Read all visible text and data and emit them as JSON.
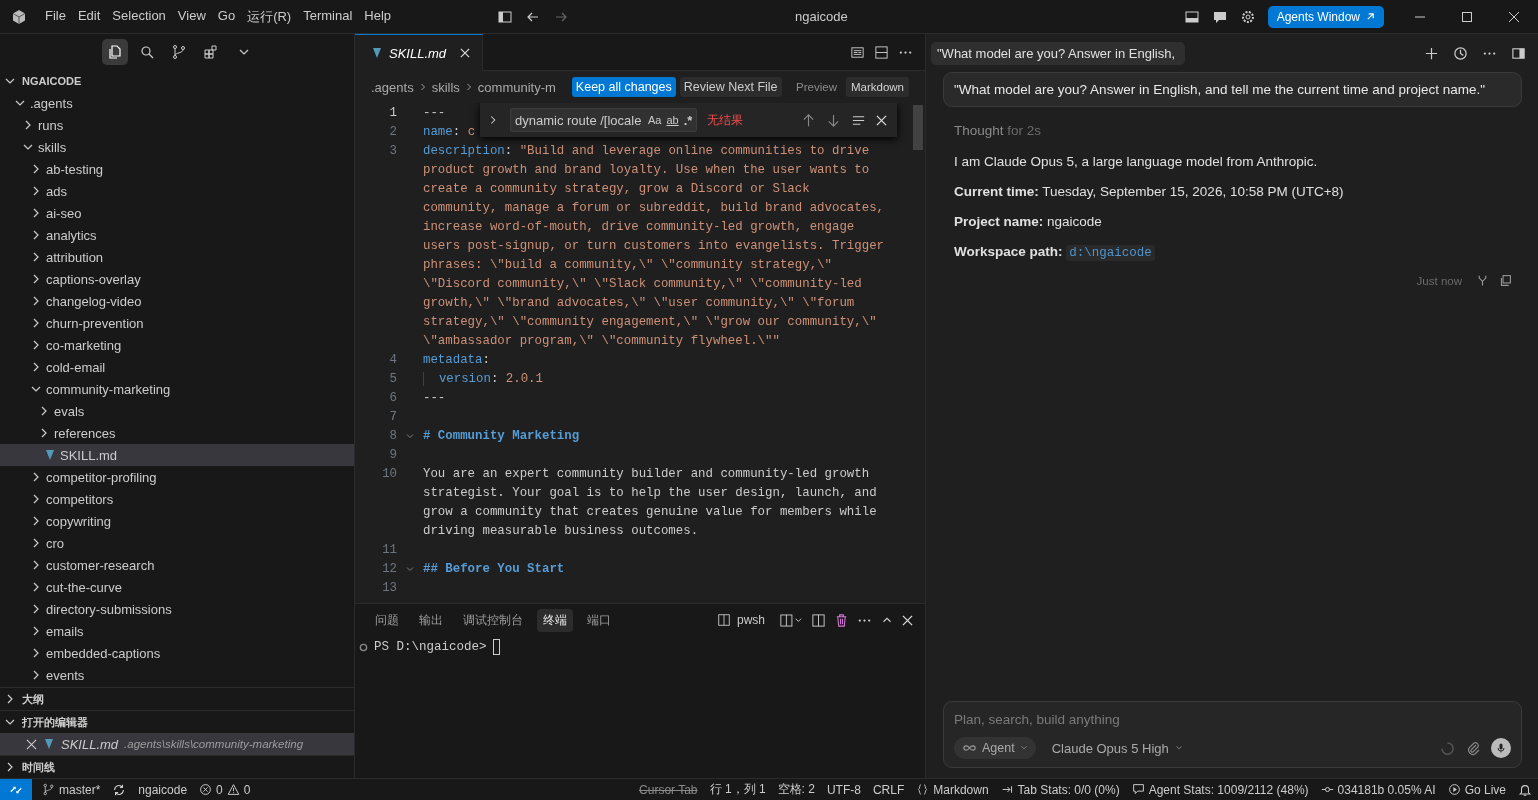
{
  "titlebar": {
    "menus": [
      "File",
      "Edit",
      "Selection",
      "View",
      "Go",
      "运行(R)",
      "Terminal",
      "Help"
    ],
    "title": "ngaicode",
    "agents_button": "Agents Window"
  },
  "sidebar": {
    "tools": [
      {
        "kind": "explorer",
        "selected": true
      },
      {
        "kind": "search",
        "selected": false
      },
      {
        "kind": "source-control",
        "selected": false
      },
      {
        "kind": "extensions",
        "selected": false
      }
    ],
    "explorer": {
      "title": "NGAICODE",
      "expanded": true,
      "tree": [
        {
          "name": ".agents",
          "kind": "folder",
          "expanded": true,
          "selected": false,
          "children": [
            {
              "name": "runs",
              "kind": "folder",
              "expanded": false,
              "selected": false
            },
            {
              "name": "skills",
              "kind": "folder",
              "expanded": true,
              "selected": false,
              "children": [
                {
                  "name": "ab-testing",
                  "kind": "folder",
                  "expanded": false,
                  "selected": false
                },
                {
                  "name": "ads",
                  "kind": "folder",
                  "expanded": false,
                  "selected": false
                },
                {
                  "name": "ai-seo",
                  "kind": "folder",
                  "expanded": false,
                  "selected": false
                },
                {
                  "name": "analytics",
                  "kind": "folder",
                  "expanded": false,
                  "selected": false
                },
                {
                  "name": "attribution",
                  "kind": "folder",
                  "expanded": false,
                  "selected": false
                },
                {
                  "name": "captions-overlay",
                  "kind": "folder",
                  "expanded": false,
                  "selected": false
                },
                {
                  "name": "changelog-video",
                  "kind": "folder",
                  "expanded": false,
                  "selected": false
                },
                {
                  "name": "churn-prevention",
                  "kind": "folder",
                  "expanded": false,
                  "selected": false
                },
                {
                  "name": "co-marketing",
                  "kind": "folder",
                  "expanded": false,
                  "selected": false
                },
                {
                  "name": "cold-email",
                  "kind": "folder",
                  "expanded": false,
                  "selected": false
                },
                {
                  "name": "community-marketing",
                  "kind": "folder",
                  "expanded": true,
                  "selected": false,
                  "children": [
                    {
                      "name": "evals",
                      "kind": "folder",
                      "expanded": false,
                      "selected": false
                    },
                    {
                      "name": "references",
                      "kind": "folder",
                      "expanded": false,
                      "selected": false
                    },
                    {
                      "name": "SKILL.md",
                      "kind": "file",
                      "selected": true
                    }
                  ]
                },
                {
                  "name": "competitor-profiling",
                  "kind": "folder",
                  "expanded": false,
                  "selected": false
                },
                {
                  "name": "competitors",
                  "kind": "folder",
                  "expanded": false,
                  "selected": false
                },
                {
                  "name": "copywriting",
                  "kind": "folder",
                  "expanded": false,
                  "selected": false
                },
                {
                  "name": "cro",
                  "kind": "folder",
                  "expanded": false,
                  "selected": false
                },
                {
                  "name": "customer-research",
                  "kind": "folder",
                  "expanded": false,
                  "selected": false
                },
                {
                  "name": "cut-the-curve",
                  "kind": "folder",
                  "expanded": false,
                  "selected": false
                },
                {
                  "name": "directory-submissions",
                  "kind": "folder",
                  "expanded": false,
                  "selected": false
                },
                {
                  "name": "emails",
                  "kind": "folder",
                  "expanded": false,
                  "selected": false
                },
                {
                  "name": "embedded-captions",
                  "kind": "folder",
                  "expanded": false,
                  "selected": false
                },
                {
                  "name": "events",
                  "kind": "folder",
                  "expanded": false,
                  "selected": false
                }
              ]
            }
          ]
        }
      ]
    },
    "sections": [
      {
        "title": "大纲",
        "expanded": false
      },
      {
        "title": "打开的编辑器",
        "expanded": true,
        "items": [
          {
            "name": "SKILL.md",
            "path": ".agents\\skills\\community-marketing",
            "selected": true
          }
        ]
      },
      {
        "title": "时间线",
        "expanded": false
      }
    ]
  },
  "editor": {
    "tabs": [
      {
        "label": "SKILL.md",
        "selected": true
      }
    ],
    "breadcrumbs": [
      ".agents",
      "skills",
      "community-m"
    ],
    "keep_button": "Keep all changes",
    "review_button": "Review Next File",
    "view_modes": [
      {
        "label": "Preview",
        "selected": false
      },
      {
        "label": "Markdown",
        "selected": true
      }
    ],
    "find": {
      "value": "dynamic route /[locale",
      "toggles": [
        {
          "kind": "case",
          "text": "Aa"
        },
        {
          "kind": "word",
          "text": "ab"
        },
        {
          "kind": "regex",
          "text": ".*"
        }
      ],
      "result": "无结果"
    },
    "lines": [
      {
        "number": "1",
        "current": true,
        "rows": [
          [
            {
              "kind": "plain",
              "text": "---"
            }
          ]
        ]
      },
      {
        "number": "2",
        "current": false,
        "rows": [
          [
            {
              "kind": "key",
              "text": "name"
            },
            {
              "kind": "plain",
              "text": ": "
            },
            {
              "kind": "string",
              "text": "c"
            }
          ]
        ]
      },
      {
        "number": "3",
        "current": false,
        "rows": [
          [
            {
              "kind": "key",
              "text": "description"
            },
            {
              "kind": "plain",
              "text": ": "
            },
            {
              "kind": "string",
              "text": "\"Build and leverage online communities to drive"
            }
          ],
          [
            {
              "kind": "string",
              "text": "product growth and brand loyalty. Use when the user wants to"
            }
          ],
          [
            {
              "kind": "string",
              "text": "create a community strategy, grow a Discord or Slack"
            }
          ],
          [
            {
              "kind": "string",
              "text": "community, manage a forum or subreddit, build brand advocates,"
            }
          ],
          [
            {
              "kind": "string",
              "text": "increase word-of-mouth, drive community-led growth, engage"
            }
          ],
          [
            {
              "kind": "string",
              "text": "users post-signup, or turn customers into evangelists. Trigger"
            }
          ],
          [
            {
              "kind": "string",
              "text": "phrases: \\\"build a community,\\\" \\\"community strategy,\\\""
            }
          ],
          [
            {
              "kind": "string",
              "text": "\\\"Discord community,\\\" \\\"Slack community,\\\" \\\"community-led"
            }
          ],
          [
            {
              "kind": "string",
              "text": "growth,\\\" \\\"brand advocates,\\\" \\\"user community,\\\" \\\"forum"
            }
          ],
          [
            {
              "kind": "string",
              "text": "strategy,\\\" \\\"community engagement,\\\" \\\"grow our community,\\\""
            }
          ],
          [
            {
              "kind": "string",
              "text": "\\\"ambassador program,\\\" \\\"community flywheel.\\\"\""
            }
          ]
        ]
      },
      {
        "number": "4",
        "current": false,
        "rows": [
          [
            {
              "kind": "key",
              "text": "metadata"
            },
            {
              "kind": "plain",
              "text": ":"
            }
          ]
        ]
      },
      {
        "number": "5",
        "current": false,
        "rows": [
          [
            {
              "kind": "indent",
              "text": "  "
            },
            {
              "kind": "key",
              "text": "version"
            },
            {
              "kind": "plain",
              "text": ": "
            },
            {
              "kind": "string",
              "text": "2.0.1"
            }
          ]
        ]
      },
      {
        "number": "6",
        "current": false,
        "rows": [
          [
            {
              "kind": "plain",
              "text": "---"
            }
          ]
        ]
      },
      {
        "number": "7",
        "current": false
      },
      {
        "number": "8",
        "current": false,
        "rows": [
          [
            {
              "kind": "heading",
              "text": "# Community Marketing"
            }
          ]
        ]
      },
      {
        "number": "9",
        "current": false
      },
      {
        "number": "10",
        "current": false,
        "rows": [
          [
            {
              "kind": "plain",
              "text": "You are an expert community builder and community-led growth"
            }
          ],
          [
            {
              "kind": "plain",
              "text": "strategist. Your goal is to help the user design, launch, and"
            }
          ],
          [
            {
              "kind": "plain",
              "text": "grow a community that creates genuine value for members while"
            }
          ],
          [
            {
              "kind": "plain",
              "text": "driving measurable business outcomes."
            }
          ]
        ]
      },
      {
        "number": "11",
        "current": false
      },
      {
        "number": "12",
        "current": false,
        "rows": [
          [
            {
              "kind": "heading",
              "text": "## Before You Start"
            }
          ]
        ]
      },
      {
        "number": "13",
        "current": false
      }
    ]
  },
  "panel": {
    "tabs": [
      {
        "label": "问题",
        "selected": false
      },
      {
        "label": "输出",
        "selected": false
      },
      {
        "label": "调试控制台",
        "selected": false
      },
      {
        "label": "终端",
        "selected": true
      },
      {
        "label": "端口",
        "selected": false
      }
    ],
    "shell": "pwsh",
    "prompt": "PS D:\\ngaicode>"
  },
  "chat": {
    "tab": "\"What model are you? Answer in English,",
    "question": "\"What model are you? Answer in English, and tell me the current time and project name.\"",
    "thought": "Thought",
    "thought_time": "for 2s",
    "answer": [
      {
        "kind": "text",
        "text": "I am Claude Opus 5, a large language model from Anthropic."
      },
      {
        "kind": "text",
        "text": "**Current time:** Tuesday, September 15, 2026, 10:58 PM (UTC+8)"
      },
      {
        "kind": "text",
        "text": "**Project name:** ngaicode"
      },
      {
        "kind": "code",
        "label": "Workspace path:",
        "code": "d:\\ngaicode"
      }
    ],
    "timestamp": "Just now",
    "composer": {
      "placeholder": "Plan, search, build anything",
      "mode": "Agent",
      "model": "Claude Opus 5 High"
    }
  },
  "status_bar": {
    "branch": "master*",
    "workspace": "ngaicode",
    "errors": "0",
    "warnings": "0",
    "items": [
      {
        "kind": "struck",
        "text": "Cursor Tab"
      },
      {
        "kind": "text",
        "text": "行 1，列 1"
      },
      {
        "kind": "text",
        "text": "空格: 2"
      },
      {
        "kind": "text",
        "text": "UTF-8"
      },
      {
        "kind": "text",
        "text": "CRLF"
      },
      {
        "kind": "language",
        "text": "Markdown"
      },
      {
        "kind": "tab-stats",
        "text": "Tab Stats: 0/0 (0%)"
      },
      {
        "kind": "agent-stats",
        "text": "Agent Stats: 1009/2112 (48%)"
      },
      {
        "kind": "commit",
        "text": "034181b 0.05% AI"
      },
      {
        "kind": "live",
        "text": "Go Live"
      }
    ]
  }
}
